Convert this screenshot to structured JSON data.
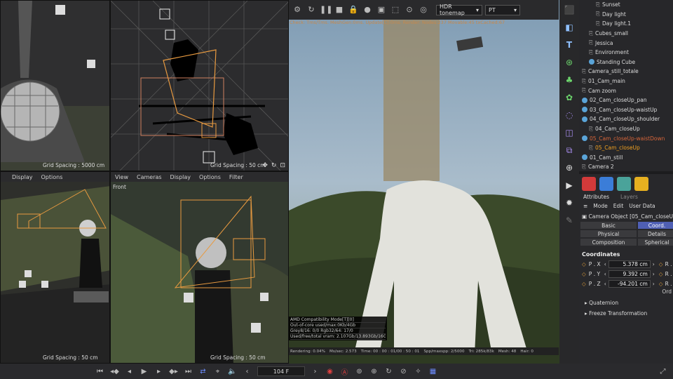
{
  "viewport_tl": {
    "grid_spacing": "Grid Spacing : 5000 cm"
  },
  "viewport_tc": {
    "grid_spacing": "Grid Spacing : 50 cm"
  },
  "viewport_bl": {
    "menu": [
      "Display",
      "Options"
    ],
    "grid_spacing": "Grid Spacing : 50 cm"
  },
  "viewport_bc": {
    "menu": [
      "View",
      "Cameras",
      "Display",
      "Options",
      "Filter"
    ],
    "label": "Front",
    "grid_spacing": "Grid Spacing : 50 cm"
  },
  "render": {
    "tonemap": "HDR tonemap",
    "kernel": "PT",
    "status_line": "Check: Tms/Tms. MeshGen:0ms. Update[C]:0ms. Render: Nodes:237 Movable:45 txCached:67",
    "stats": [
      "AMD Compatibility Mode[T][0]",
      "Out-of-core used/max:0Kb/4Gb",
      "Grey8/16: 0/0          Rgb32/64: 17/0",
      "Used/free/total vram: 2.107Gb/13.893Gb/16Gb"
    ],
    "bottom": [
      "Rendering: 0.04%",
      "Ms/sec: 2.573",
      "Time: 00 : 00 : 01/00 : 50 : 01",
      "Spp/maxspp: 2/5000",
      "Tri: 285k/83k",
      "Mesh: 48",
      "Hair: 0"
    ]
  },
  "timeline": {
    "frame": "104 F"
  },
  "objects": [
    {
      "label": "Sunset",
      "indent": 2,
      "dot": false
    },
    {
      "label": "Day light",
      "indent": 2,
      "dot": false
    },
    {
      "label": "Day light.1",
      "indent": 2,
      "dot": false
    },
    {
      "label": "Cubes_small",
      "indent": 1,
      "dot": false
    },
    {
      "label": "Jessica",
      "indent": 1,
      "dot": false
    },
    {
      "label": "Environment",
      "indent": 1,
      "dot": false
    },
    {
      "label": "Standing Cube",
      "indent": 1,
      "dot": true
    },
    {
      "label": "Camera_still_totale",
      "indent": 0,
      "dot": false
    },
    {
      "label": "01_Cam_main",
      "indent": 0,
      "dot": false
    },
    {
      "label": "Cam zoom",
      "indent": 0,
      "dot": false
    },
    {
      "label": "02_Cam_closeUp_pan",
      "indent": 0,
      "dot": true
    },
    {
      "label": "03_Cam_closeUp-waistUp",
      "indent": 0,
      "dot": true
    },
    {
      "label": "04_Cam_closeUp_shoulder",
      "indent": 0,
      "dot": true
    },
    {
      "label": "04_Cam_closeUp",
      "indent": 1,
      "dot": false
    },
    {
      "label": "05_Cam_closeUp-waistDown",
      "indent": 0,
      "dot": true,
      "color": "#d9663a"
    },
    {
      "label": "05_Cam_closeUp",
      "indent": 1,
      "dot": false,
      "color": "#f0a020"
    },
    {
      "label": "01_Cam_still",
      "indent": 0,
      "dot": true
    },
    {
      "label": "Camera 2",
      "indent": 0,
      "dot": false
    }
  ],
  "attributes": {
    "tabs": [
      "Attributes",
      "Layers"
    ],
    "menu": [
      "Mode",
      "Edit",
      "User Data"
    ],
    "object": "Camera Object [05_Cam_closeU",
    "subtabs": [
      "Basic",
      "Coord.",
      "Physical",
      "Details",
      "Composition",
      "Spherical"
    ],
    "section": "Coordinates",
    "coords": [
      {
        "label": "P . X",
        "value": "5.378 cm"
      },
      {
        "label": "P . Y",
        "value": "9.392 cm"
      },
      {
        "label": "P . Z",
        "value": "-94.201 cm"
      }
    ],
    "rot_label": "R .",
    "order": "Ord",
    "quaternion": "Quaternion",
    "freeze": "Freeze Transformation"
  }
}
